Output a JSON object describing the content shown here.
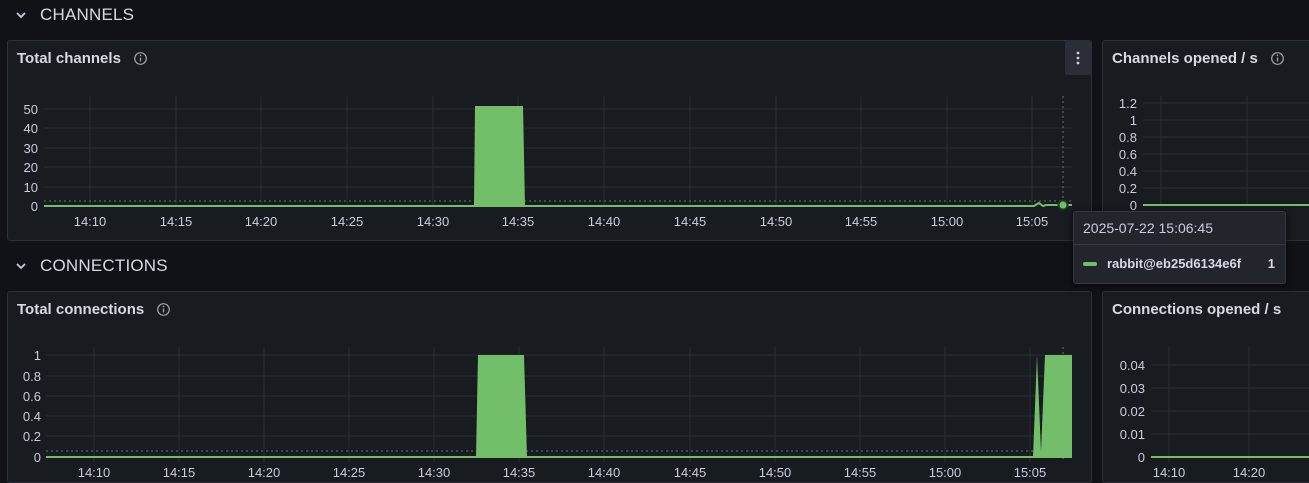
{
  "rows": [
    {
      "title": "CHANNELS"
    },
    {
      "title": "CONNECTIONS"
    }
  ],
  "panels": {
    "total_channels": {
      "title": "Total channels",
      "y_ticks": [
        "50",
        "40",
        "30",
        "20",
        "10",
        "0"
      ],
      "x_ticks": [
        "14:10",
        "14:15",
        "14:20",
        "14:25",
        "14:30",
        "14:35",
        "14:40",
        "14:45",
        "14:50",
        "14:55",
        "15:00",
        "15:05"
      ]
    },
    "channels_opened": {
      "title": "Channels opened / s",
      "y_ticks": [
        "1.2",
        "1",
        "0.8",
        "0.6",
        "0.4",
        "0.2",
        "0"
      ]
    },
    "total_connections": {
      "title": "Total connections",
      "y_ticks": [
        "1",
        "0.8",
        "0.6",
        "0.4",
        "0.2",
        "0"
      ],
      "x_ticks": [
        "14:10",
        "14:15",
        "14:20",
        "14:25",
        "14:30",
        "14:35",
        "14:40",
        "14:45",
        "14:50",
        "14:55",
        "15:00",
        "15:05"
      ]
    },
    "connections_opened": {
      "title": "Connections opened / s",
      "y_ticks": [
        "0.04",
        "0.03",
        "0.02",
        "0.01",
        "0"
      ],
      "x_ticks": [
        "14:10",
        "14:20"
      ]
    }
  },
  "tooltip": {
    "time": "2025-07-22 15:06:45",
    "series": "rabbit@eb25d6134e6f",
    "value": "1"
  },
  "colors": {
    "series": "#73bf69",
    "background": "#111217",
    "panel": "#181b1f",
    "grid": "#2a2d33"
  },
  "icons": [
    "chevron-down-icon",
    "info-icon",
    "menu-dots-icon"
  ],
  "chart_data": [
    {
      "type": "area",
      "title": "Total channels",
      "series": [
        {
          "name": "rabbit@eb25d6134e6f",
          "points": [
            [
              "14:07",
              0
            ],
            [
              "14:32",
              0
            ],
            [
              "14:32",
              51
            ],
            [
              "14:35",
              51
            ],
            [
              "14:35",
              0
            ],
            [
              "15:05",
              0
            ],
            [
              "15:05",
              1
            ],
            [
              "15:06",
              1
            ]
          ]
        }
      ],
      "ylim": [
        0,
        55
      ]
    },
    {
      "type": "area",
      "title": "Channels opened / s",
      "series": [
        {
          "name": "rabbit@eb25d6134e6f",
          "values": [
            0,
            0
          ]
        }
      ],
      "ylim": [
        0,
        1.2
      ]
    },
    {
      "type": "area",
      "title": "Total connections",
      "series": [
        {
          "name": "rabbit@eb25d6134e6f",
          "points": [
            [
              "14:07",
              0
            ],
            [
              "14:32",
              0
            ],
            [
              "14:32",
              1
            ],
            [
              "14:35",
              1
            ],
            [
              "14:35",
              0
            ],
            [
              "15:05",
              0
            ],
            [
              "15:05",
              1
            ],
            [
              "15:06",
              1
            ]
          ]
        }
      ],
      "ylim": [
        0,
        1
      ]
    },
    {
      "type": "area",
      "title": "Connections opened / s",
      "series": [
        {
          "name": "rabbit@eb25d6134e6f",
          "values": [
            0,
            0
          ]
        }
      ],
      "ylim": [
        0,
        0.04
      ]
    }
  ]
}
